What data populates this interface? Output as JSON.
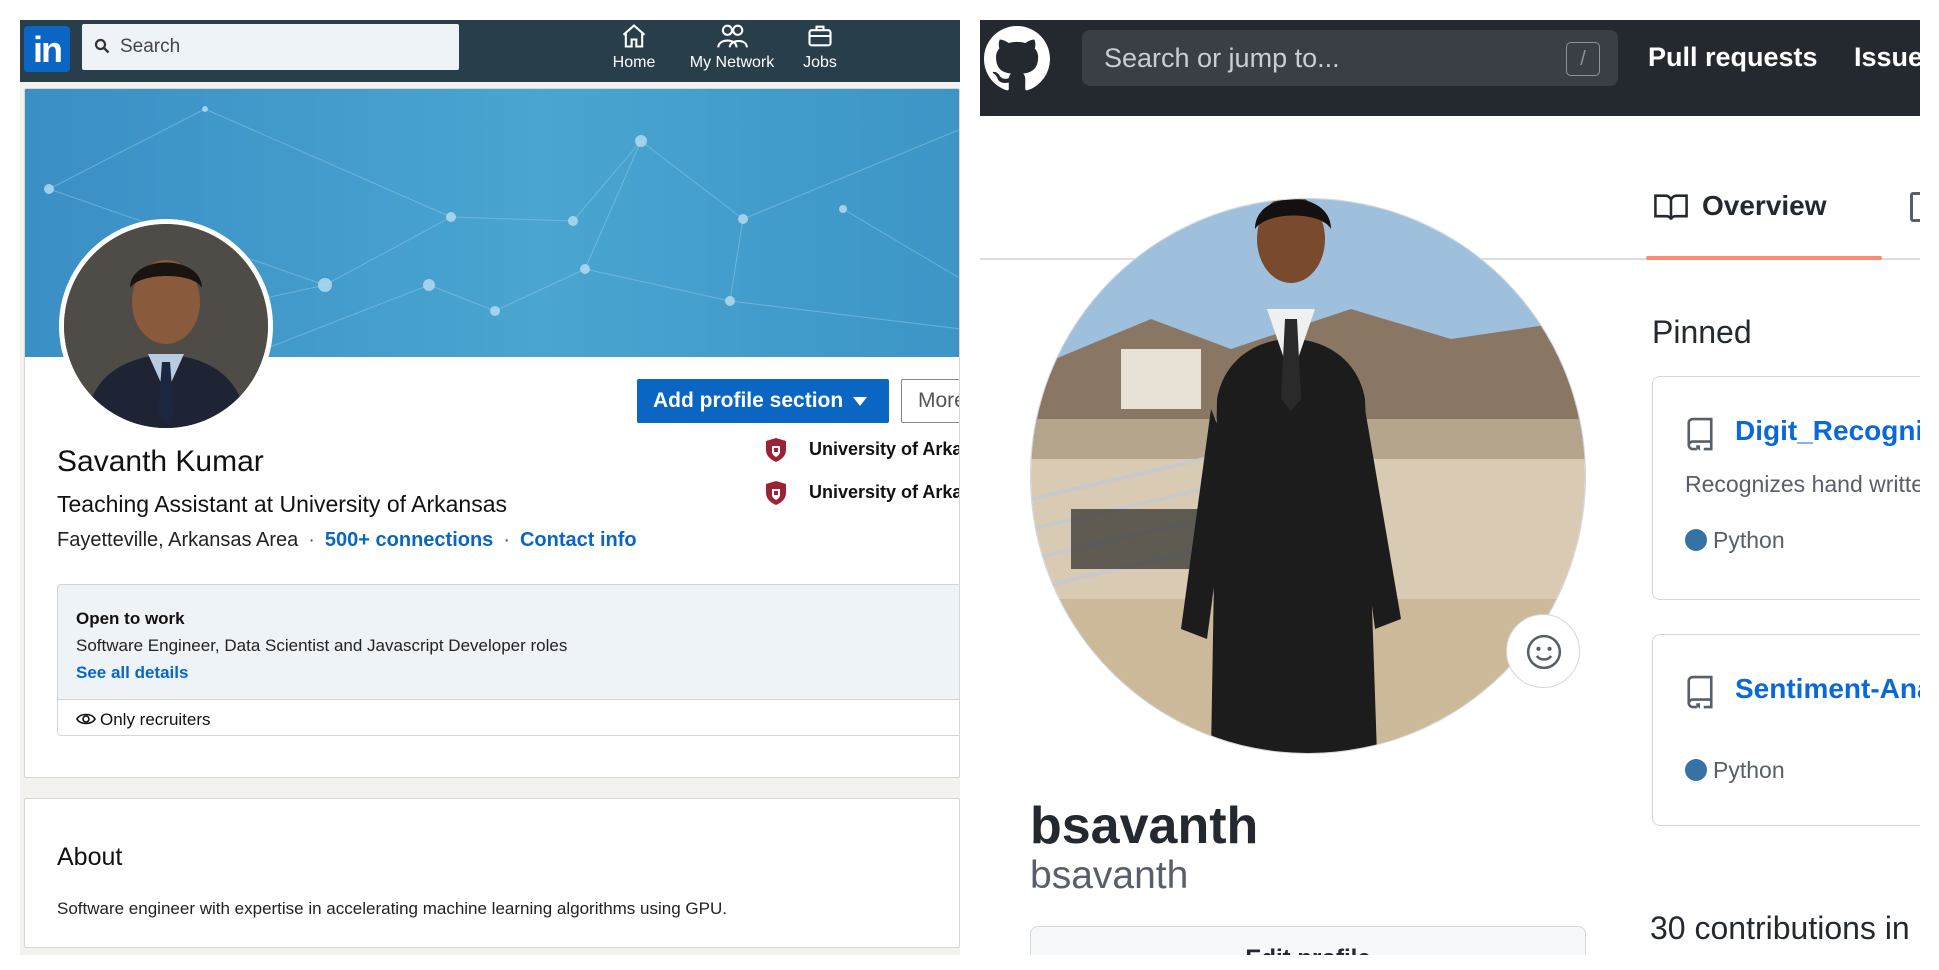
{
  "linkedin": {
    "logo_text": "in",
    "search": {
      "placeholder": "Search"
    },
    "nav": {
      "home": "Home",
      "network": "My Network",
      "jobs": "Jobs"
    },
    "profile": {
      "name": "Savanth Kumar",
      "headline": "Teaching Assistant at University of Arkansas",
      "location": "Fayetteville, Arkansas Area",
      "connections": "500+ connections",
      "contact": "Contact info",
      "separator": "·",
      "add_section": "Add profile section",
      "more": "More",
      "education": [
        "University of Arkansas",
        "University of Arkansas"
      ]
    },
    "open_to_work": {
      "title": "Open to work",
      "roles": "Software Engineer, Data Scientist and Javascript Developer roles",
      "see_all": "See all details",
      "visibility": "Only recruiters"
    },
    "about": {
      "title": "About",
      "text": "Software engineer with expertise in accelerating machine learning algorithms using GPU."
    }
  },
  "github": {
    "search": {
      "placeholder": "Search or jump to...",
      "shortcut": "/"
    },
    "nav": {
      "pull_requests": "Pull requests",
      "issues": "Issues"
    },
    "tabs": {
      "overview": "Overview"
    },
    "profile": {
      "name": "bsavanth",
      "login": "bsavanth",
      "edit": "Edit profile"
    },
    "pinned_title": "Pinned",
    "pinned": [
      {
        "name": "Digit_Recognition",
        "description": "Recognizes hand written digits",
        "language": "Python"
      },
      {
        "name": "Sentiment-Analysis",
        "language": "Python"
      }
    ],
    "contributions": "30 contributions in"
  },
  "colors": {
    "linkedin_blue": "#0a66c2",
    "linkedin_nav": "#283e4a",
    "github_nav": "#24292f",
    "github_link": "#0969da",
    "python": "#3572a5",
    "tab_underline": "#fd8c73"
  },
  "icons": [
    "search-icon",
    "home-icon",
    "my-network-icon",
    "jobs-icon",
    "school-shield-icon",
    "eye-icon",
    "github-logo-icon",
    "book-icon",
    "smiley-icon",
    "repo-icon"
  ]
}
